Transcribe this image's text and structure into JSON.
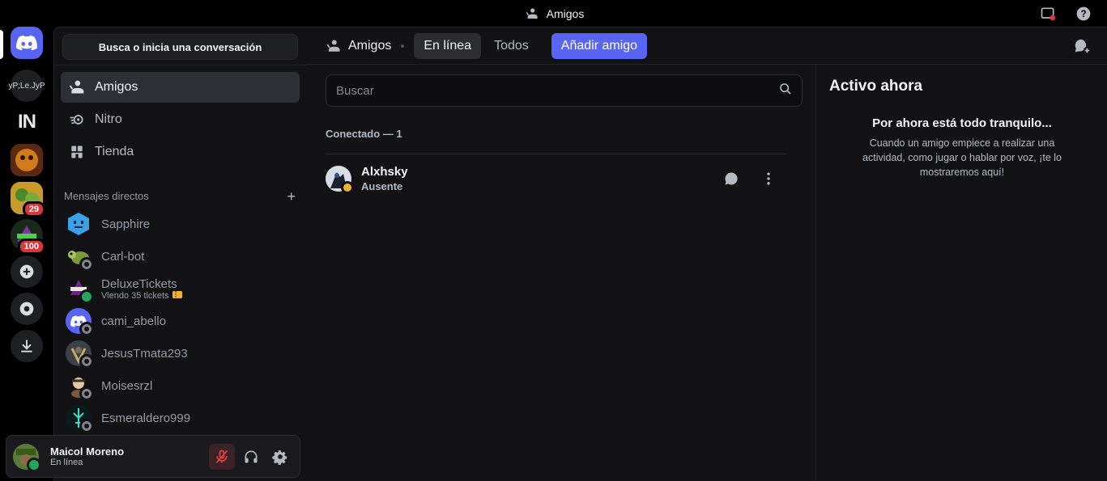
{
  "window": {
    "title": "Amigos"
  },
  "sidebar": {
    "search_label": "Busca o inicia una conversación",
    "nav": [
      {
        "label": "Amigos",
        "icon": "friends-icon",
        "active": true
      },
      {
        "label": "Nitro",
        "icon": "nitro-icon",
        "active": false
      },
      {
        "label": "Tienda",
        "icon": "shop-icon",
        "active": false
      }
    ],
    "dm_header": "Mensajes directos",
    "dms": [
      {
        "name": "Sapphire",
        "sub": "",
        "status": "none",
        "color": "#3aa0e8"
      },
      {
        "name": "Carl-bot",
        "sub": "",
        "status": "offline",
        "color": "#7d9a3a"
      },
      {
        "name": "DeluxeTickets",
        "sub": "Viendo 35 tickets",
        "status": "online",
        "color": "#6a2a7a"
      },
      {
        "name": "cami_abello",
        "sub": "",
        "status": "offline",
        "color": "#5865f2"
      },
      {
        "name": "JesusTmata293",
        "sub": "",
        "status": "offline",
        "color": "#3a3f48"
      },
      {
        "name": "Moisesrzl",
        "sub": "",
        "status": "offline",
        "color": "#5a4a3a"
      },
      {
        "name": "Esmeraldero999",
        "sub": "",
        "status": "offline",
        "color": "#1d4a4a"
      }
    ]
  },
  "servers": [
    {
      "label": "yP;Le.JyP",
      "type": "text"
    },
    {
      "label": "IN",
      "type": "logo"
    },
    {
      "label": "",
      "type": "image",
      "color": "#c8661a"
    },
    {
      "label": "",
      "type": "image",
      "color": "#6a8a2a",
      "badge": "29"
    },
    {
      "label": "",
      "type": "image",
      "color": "#1a3a1a",
      "badge": "100"
    }
  ],
  "user": {
    "name": "Maicol Moreno",
    "status": "En línea"
  },
  "header": {
    "title": "Amigos",
    "tabs": [
      "En línea",
      "Todos"
    ],
    "add_friend": "Añadir amigo"
  },
  "friends": {
    "search_placeholder": "Buscar",
    "section_title": "Conectado — 1",
    "list": [
      {
        "name": "Alxhsky",
        "status": "Ausente"
      }
    ]
  },
  "active_now": {
    "title": "Activo ahora",
    "empty_title": "Por ahora está todo tranquilo...",
    "empty_body": "Cuando un amigo empiece a realizar una actividad, como jugar o hablar por voz, ¡te lo mostraremos aquí!"
  },
  "colors": {
    "accent": "#5865f2",
    "online": "#23a55a",
    "idle": "#f0b232",
    "danger": "#da373c"
  }
}
